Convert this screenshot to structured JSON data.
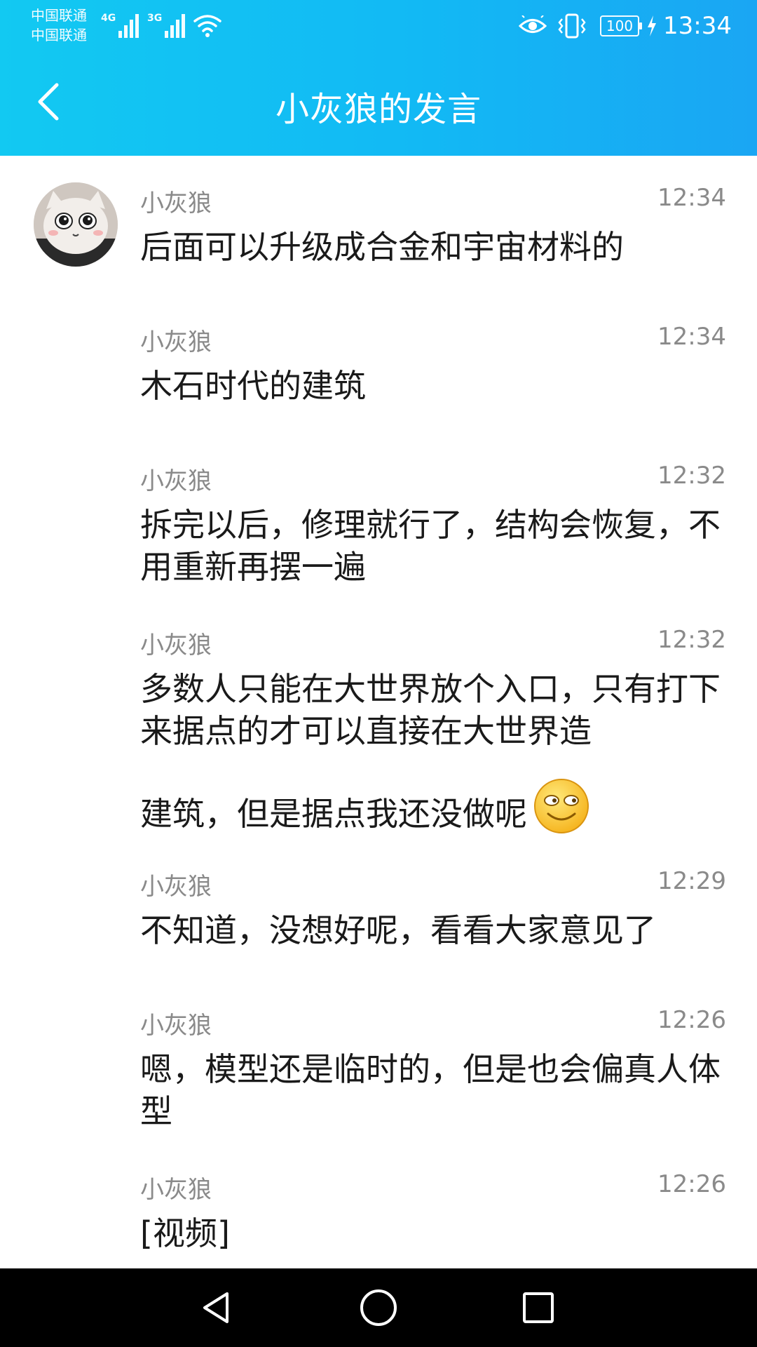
{
  "status_bar": {
    "carrier_1": "中国联通",
    "carrier_2": "中国联通",
    "network_1": "4G",
    "network_2": "3G",
    "signal_1_icon": "signal-bars-icon",
    "signal_2_icon": "signal-bars-icon",
    "wifi_icon": "wifi-icon",
    "eye_icon": "eye-comfort-icon",
    "vibrate_icon": "vibrate-icon",
    "battery_level": "100",
    "charging_icon": "charging-bolt-icon",
    "time": "13:34"
  },
  "header": {
    "title": "小灰狼的发言",
    "back_icon": "chevron-left-icon"
  },
  "messages": [
    {
      "sender": "小灰狼",
      "time": "12:34",
      "text": "后面可以升级成合金和宇宙材料的"
    },
    {
      "sender": "小灰狼",
      "time": "12:34",
      "text": "木石时代的建筑"
    },
    {
      "sender": "小灰狼",
      "time": "12:32",
      "text": "拆完以后，修理就行了，结构会恢复，不用重新再摆一遍"
    },
    {
      "sender": "小灰狼",
      "time": "12:32",
      "text": "多数人只能在大世界放个入口，只有打下来据点的才可以直接在大世界造",
      "text_2": "建筑，但是据点我还没做呢",
      "emoji": "smug-face-emoji"
    },
    {
      "sender": "小灰狼",
      "time": "12:29",
      "text": "不知道，没想好呢，看看大家意见了"
    },
    {
      "sender": "小灰狼",
      "time": "12:26",
      "text": "嗯，模型还是临时的，但是也会偏真人体型"
    },
    {
      "sender": "小灰狼",
      "time": "12:26",
      "text": "[视频]"
    }
  ],
  "avatar_icon": "cat-avatar-icon",
  "nav_bar": {
    "back_icon": "triangle-back-icon",
    "home_icon": "circle-home-icon",
    "recents_icon": "square-recents-icon"
  },
  "colors": {
    "header_start": "#12c9f2",
    "header_end": "#1aa6f3",
    "meta_text": "#8a8a8a",
    "body_text": "#1a1a1a",
    "nav_bar": "#000000"
  }
}
